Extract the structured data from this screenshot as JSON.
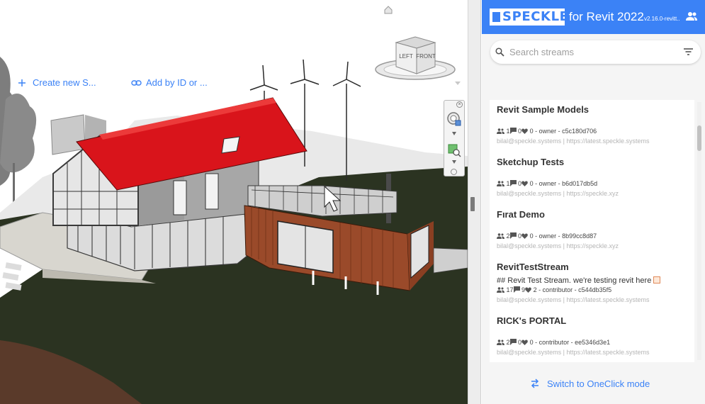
{
  "viewport": {
    "viewcube": {
      "left_label": "LEFT",
      "front_label": "FRONT"
    }
  },
  "panel": {
    "logo_text": "SPECKLE",
    "title": "for Revit 2022",
    "version": "v2.16.0-revitt...",
    "account_icon": "account-group-icon",
    "search": {
      "placeholder": "Search streams",
      "value": ""
    },
    "actions": {
      "create_label": "Create new S...",
      "add_label": "Add by ID or ..."
    },
    "streams": [
      {
        "name": "Revit Sample Models",
        "description": "",
        "collaborators": "1",
        "comments": "0",
        "favorites": "0",
        "role": "owner",
        "id": "c5c180d706",
        "server": "bilal@speckle.systems | https://latest.speckle.systems"
      },
      {
        "name": "Sketchup Tests",
        "description": "",
        "collaborators": "1",
        "comments": "0",
        "favorites": "0",
        "role": "owner",
        "id": "b6d017db5d",
        "server": "bilal@speckle.systems | https://speckle.xyz"
      },
      {
        "name": "Fırat Demo",
        "description": "",
        "collaborators": "2",
        "comments": "0",
        "favorites": "0",
        "role": "owner",
        "id": "8b99cc8d87",
        "server": "bilal@speckle.systems | https://speckle.xyz"
      },
      {
        "name": "RevitTestStream",
        "description": "## Revit Test Stream. we're testing revit here",
        "collaborators": "17",
        "comments": "9",
        "favorites": "2",
        "role": "contributor",
        "id": "c544db35f5",
        "server": "bilal@speckle.systems | https://latest.speckle.systems"
      },
      {
        "name": "RICK's PORTAL",
        "description": "",
        "collaborators": "2",
        "comments": "0",
        "favorites": "0",
        "role": "contributor",
        "id": "ee5346d3e1",
        "server": "bilal@speckle.systems | https://latest.speckle.systems"
      }
    ],
    "oneclick_label": "Switch to OneClick mode"
  },
  "colors": {
    "accent": "#3b82f6",
    "roof": "#d9141b",
    "cladding": "#9a4a2a",
    "ground": "#2b3321"
  }
}
